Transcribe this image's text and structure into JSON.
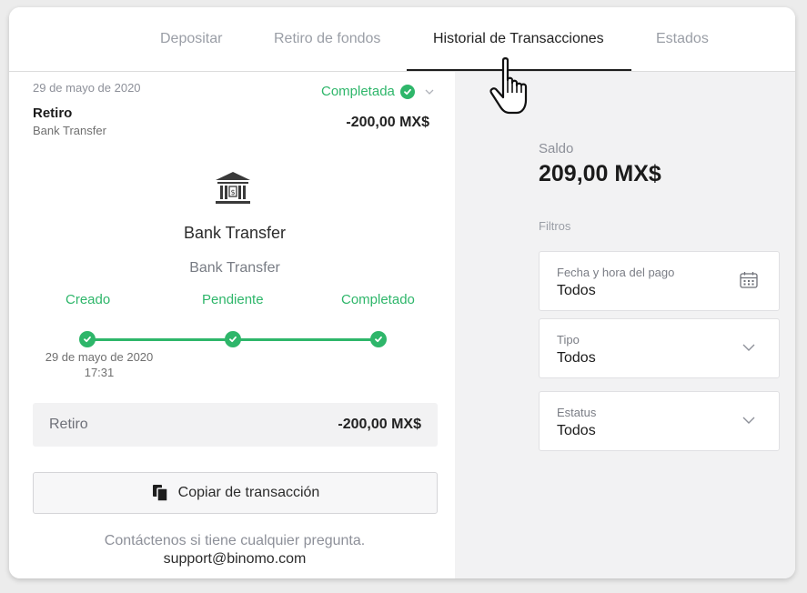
{
  "tabs": {
    "items": [
      {
        "label": "Depositar"
      },
      {
        "label": "Retiro de fondos"
      },
      {
        "label": "Historial de Transacciones"
      },
      {
        "label": "Estados"
      }
    ],
    "active": "Historial de Transacciones"
  },
  "transaction": {
    "date": "29 de mayo de 2020",
    "status": "Completada",
    "type": "Retiro",
    "method_short": "Bank Transfer",
    "amount": "-200,00 MX$",
    "method_title": "Bank Transfer",
    "method_subtitle": "Bank Transfer",
    "steps": [
      {
        "label": "Creado"
      },
      {
        "label": "Pendiente"
      },
      {
        "label": "Completado"
      }
    ],
    "created_date": "29 de mayo de 2020",
    "created_time": "17:31",
    "summary_label": "Retiro",
    "summary_amount": "-200,00 MX$",
    "copy_label": "Copiar de transacción",
    "contact_text": "Contáctenos si tiene cualquier pregunta.",
    "support_email": "support@binomo.com"
  },
  "balance": {
    "label": "Saldo",
    "value": "209,00 MX$"
  },
  "filters": {
    "label": "Filtros",
    "date": {
      "label": "Fecha y hora del pago",
      "value": "Todos"
    },
    "type": {
      "label": "Tipo",
      "value": "Todos"
    },
    "status": {
      "label": "Estatus",
      "value": "Todos"
    }
  },
  "colors": {
    "accent_green": "#2eb66a",
    "panel_grey": "#f2f2f3"
  },
  "icons": {
    "status": "check-circle-icon",
    "method": "bank-icon",
    "copy": "copy-icon",
    "calendar": "calendar-icon",
    "dropdown": "chevron-down-icon",
    "pointer": "hand-pointer-cursor"
  }
}
